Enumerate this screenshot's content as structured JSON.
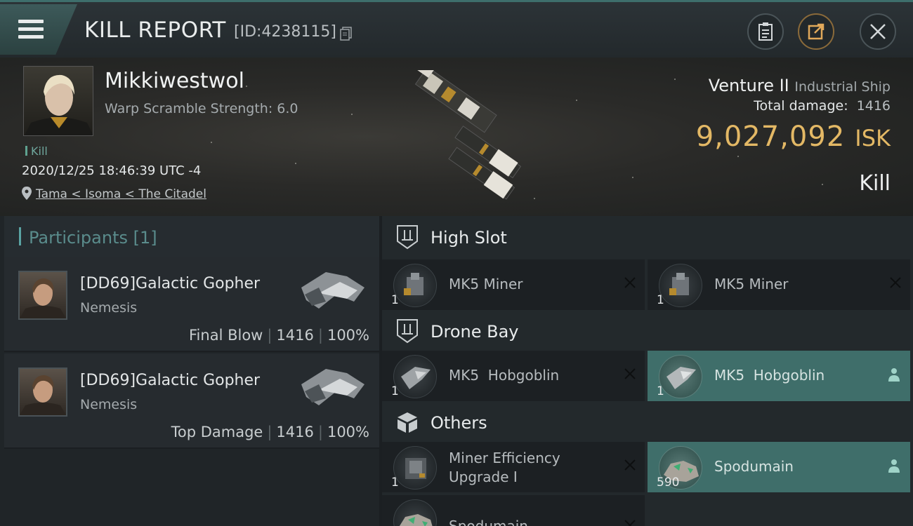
{
  "header": {
    "title": "KILL REPORT",
    "report_id": "[ID:4238115]"
  },
  "victim": {
    "name": "Mikkiwestwol",
    "warp_scramble": "Warp Scramble Strength: 6.0",
    "kill_tag": "Kill",
    "datetime": "2020/12/25 18:46:39 UTC -4",
    "location": "Tama < Isoma < The Citadel"
  },
  "ship": {
    "name": "Venture II",
    "class": "Industrial Ship",
    "total_damage_label": "Total damage:",
    "total_damage": "1416",
    "isk_value": "9,027,092",
    "isk_unit": "ISK",
    "result": "Kill"
  },
  "participants": {
    "label": "Participants [1]",
    "rows": [
      {
        "name": "[DD69]Galactic Gopher",
        "corp": "Nemesis",
        "role": "Final Blow",
        "damage": "1416",
        "percent": "100%"
      },
      {
        "name": "[DD69]Galactic Gopher",
        "corp": "Nemesis",
        "role": "Top Damage",
        "damage": "1416",
        "percent": "100%"
      }
    ]
  },
  "fittings": {
    "high_slot": {
      "label": "High Slot",
      "items": [
        {
          "name": "MK5 Miner",
          "qty": "1",
          "status": "destroyed"
        },
        {
          "name": "MK5 Miner",
          "qty": "1",
          "status": "destroyed"
        }
      ]
    },
    "drone_bay": {
      "label": "Drone Bay",
      "items": [
        {
          "name": "MK5  Hobgoblin",
          "qty": "1",
          "status": "destroyed"
        },
        {
          "name": "MK5  Hobgoblin",
          "qty": "1",
          "status": "dropped"
        }
      ]
    },
    "others": {
      "label": "Others",
      "items": [
        {
          "name_line1": "Miner Efficiency",
          "name_line2": "Upgrade I",
          "qty": "1",
          "status": "destroyed"
        },
        {
          "name": "Spodumain",
          "qty": "590",
          "status": "dropped"
        },
        {
          "name": "Spodumain",
          "qty": "",
          "status": "destroyed"
        }
      ]
    }
  },
  "colors": {
    "accent_teal": "#3f6e6a",
    "isk_gold": "#e3b865"
  }
}
